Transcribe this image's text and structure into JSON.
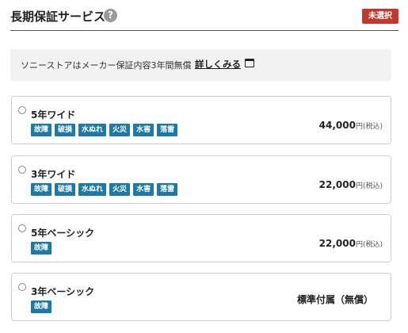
{
  "header": {
    "title": "長期保証サービス",
    "help_icon": "question-mark",
    "status_badge": "未選択",
    "status_badge_color": "#c0392b"
  },
  "info": {
    "text": "ソニーストアはメーカー保証内容3年間無償",
    "link_label": "詳しくみる",
    "link_icon": "window-open"
  },
  "plans": [
    {
      "name": "5年ワイド",
      "tags": [
        "故障",
        "破損",
        "水ぬれ",
        "火災",
        "水害",
        "落雷"
      ],
      "price": "44,000",
      "price_unit": "円(税込)"
    },
    {
      "name": "3年ワイド",
      "tags": [
        "故障",
        "破損",
        "水ぬれ",
        "火災",
        "水害",
        "落雷"
      ],
      "price": "22,000",
      "price_unit": "円(税込)"
    },
    {
      "name": "5年ベーシック",
      "tags": [
        "故障"
      ],
      "price": "22,000",
      "price_unit": "円(税込)"
    },
    {
      "name": "3年ベーシック",
      "tags": [
        "故障"
      ],
      "note": "標準付属（無償）"
    }
  ],
  "tag_color": "#1e7aa5"
}
